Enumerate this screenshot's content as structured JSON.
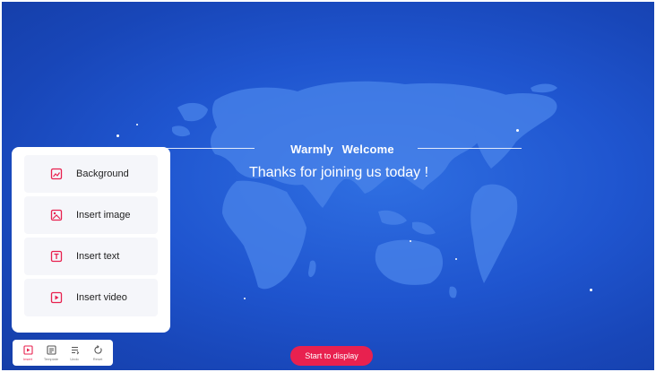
{
  "canvas": {
    "welcome_title": "Warmly  Welcome",
    "subtitle": "Thanks for joining us today !"
  },
  "side_panel": {
    "items": [
      {
        "label": "Background",
        "icon": "background-icon"
      },
      {
        "label": "Insert image",
        "icon": "image-icon"
      },
      {
        "label": "Insert text",
        "icon": "text-icon"
      },
      {
        "label": "Insert video",
        "icon": "video-icon"
      }
    ]
  },
  "toolbar": {
    "tools": [
      {
        "label": "Insert",
        "icon": "insert-icon",
        "active": true
      },
      {
        "label": "Template",
        "icon": "template-icon",
        "active": false
      },
      {
        "label": "Undo",
        "icon": "undo-icon",
        "active": false
      },
      {
        "label": "Reset",
        "icon": "reset-icon",
        "active": false
      }
    ]
  },
  "start_button": {
    "label": "Start to display"
  },
  "colors": {
    "accent": "#e8214f",
    "background": "#1f55cf",
    "map": "#4d86ec"
  }
}
